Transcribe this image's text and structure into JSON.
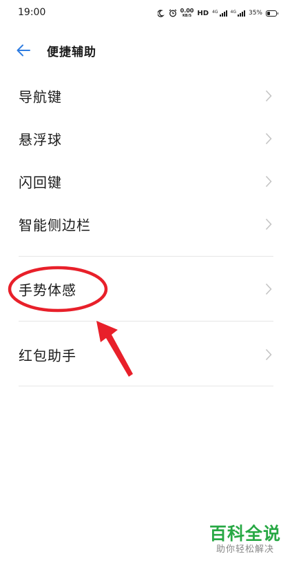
{
  "status_bar": {
    "time": "19:00",
    "speed_value": "0.00",
    "speed_unit": "KB/S",
    "hd_label": "HD",
    "net1_label": "4G",
    "net2_label": "4G",
    "battery_percent": "35%",
    "battery_level": 0.35
  },
  "header": {
    "title": "便捷辅助"
  },
  "menu": {
    "items": [
      {
        "label": "导航键"
      },
      {
        "label": "悬浮球"
      },
      {
        "label": "闪回键"
      },
      {
        "label": "智能侧边栏"
      },
      {
        "label": "手势体感"
      },
      {
        "label": "红包助手"
      }
    ]
  },
  "watermark": {
    "title": "百科全说",
    "subtitle": "助你轻松解决"
  },
  "colors": {
    "accent": "#2f7de1",
    "annotation": "#e8202a",
    "watermark": "#27a844"
  }
}
